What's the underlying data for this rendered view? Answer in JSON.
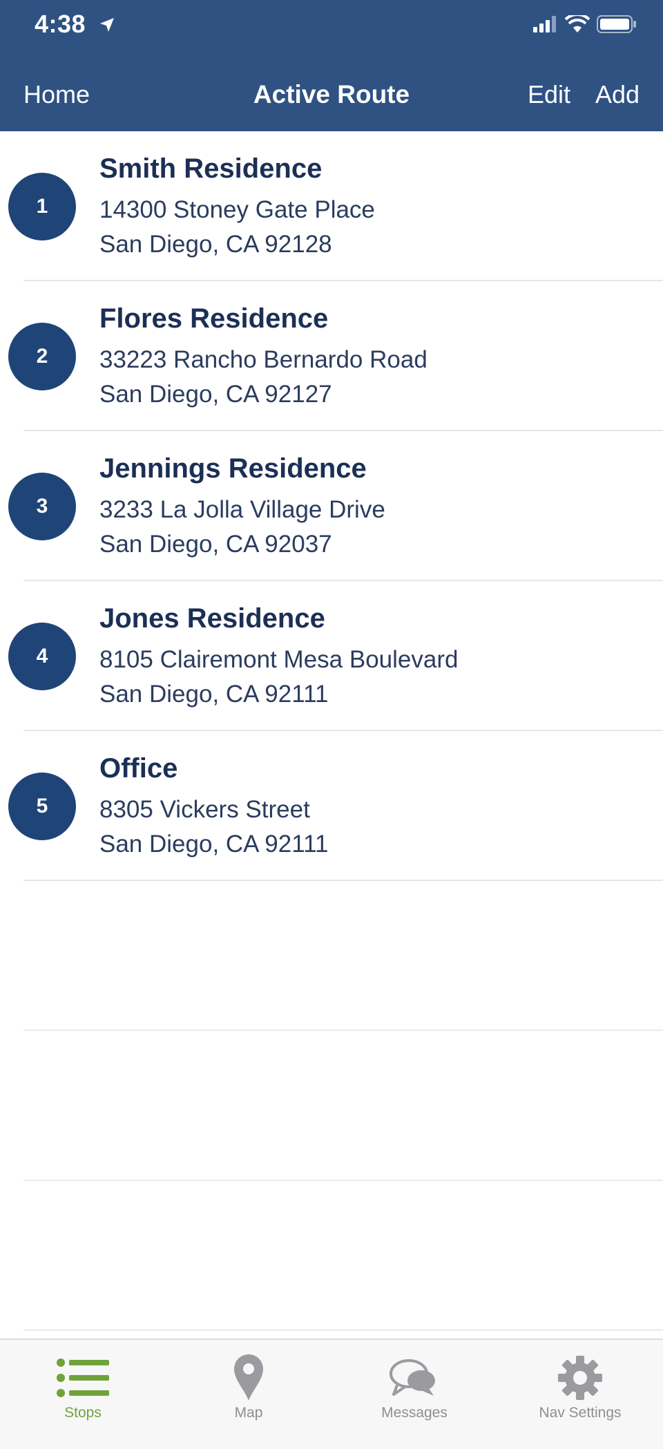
{
  "status_bar": {
    "time": "4:38"
  },
  "nav": {
    "home": "Home",
    "title": "Active Route",
    "edit": "Edit",
    "add": "Add"
  },
  "stops": [
    {
      "number": "1",
      "name": "Smith Residence",
      "street": "14300 Stoney Gate Place",
      "city": "San Diego, CA 92128"
    },
    {
      "number": "2",
      "name": "Flores Residence",
      "street": "33223 Rancho Bernardo Road",
      "city": "San Diego, CA 92127"
    },
    {
      "number": "3",
      "name": "Jennings Residence",
      "street": "3233 La Jolla Village Drive",
      "city": "San Diego, CA 92037"
    },
    {
      "number": "4",
      "name": "Jones Residence",
      "street": "8105 Clairemont Mesa Boulevard",
      "city": "San Diego, CA 92111"
    },
    {
      "number": "5",
      "name": "Office",
      "street": "8305 Vickers Street",
      "city": "San Diego, CA 92111"
    }
  ],
  "tabs": [
    {
      "label": "Stops",
      "icon": "list-icon",
      "active": true
    },
    {
      "label": "Map",
      "icon": "map-pin-icon",
      "active": false
    },
    {
      "label": "Messages",
      "icon": "chat-bubbles-icon",
      "active": false
    },
    {
      "label": "Nav Settings",
      "icon": "gear-icon",
      "active": false
    }
  ],
  "colors": {
    "header": "#2f5283",
    "badge": "#1f4478",
    "active_tab": "#6fa33a",
    "inactive_tab": "#8e8e93"
  }
}
